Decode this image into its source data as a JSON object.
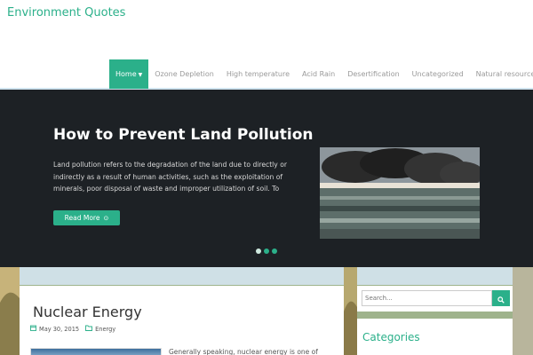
{
  "site": {
    "title": "Environment Quotes"
  },
  "nav": {
    "items": [
      {
        "label": "Home",
        "active": true
      },
      {
        "label": "Ozone Depletion"
      },
      {
        "label": "High temperature"
      },
      {
        "label": "Acid Rain"
      },
      {
        "label": "Desertification"
      },
      {
        "label": "Uncategorized"
      },
      {
        "label": "Natural resources"
      }
    ]
  },
  "slider": {
    "title": "How to Prevent Land Pollution",
    "text": "Land pollution refers to the degradation of the land due to directly or indirectly as a result of human activities, such as the exploitation of minerals, poor disposal of waste and improper utilization of soil. To",
    "button_label": "Read More",
    "slide_count": 3,
    "active_slide": 1
  },
  "post": {
    "title": "Nuclear Energy",
    "date": "May 30, 2015",
    "category": "Energy",
    "excerpt": "Generally speaking, nuclear energy is one of"
  },
  "sidebar": {
    "search_placeholder": "Search...",
    "categories_title": "Categories"
  },
  "colors": {
    "accent": "#2bb08a",
    "slider_bg": "#1d2125"
  },
  "icons": {
    "caret": "chevron-down-icon",
    "read_more": "arrow-circle-icon",
    "date": "calendar-icon",
    "category": "folder-icon",
    "search": "search-icon"
  }
}
